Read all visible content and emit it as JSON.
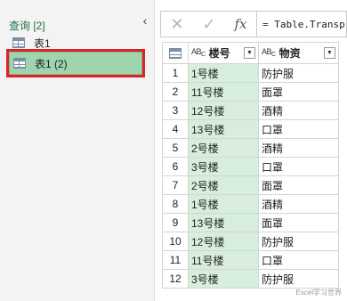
{
  "queries_pane": {
    "header": "查询 [2]",
    "collapse_glyph": "‹",
    "items": [
      {
        "label": "表1"
      },
      {
        "label": "表1 (2)"
      }
    ]
  },
  "formula_bar": {
    "cancel_glyph": "✕",
    "confirm_glyph": "✓",
    "fx_label": "fx",
    "formula": "= Table.Transp"
  },
  "grid": {
    "columns": [
      {
        "type_icon": "ABC",
        "label": "楼号"
      },
      {
        "type_icon": "ABC",
        "label": "物资"
      }
    ],
    "rows": [
      {
        "index": "1",
        "a": "1号楼",
        "b": "防护服"
      },
      {
        "index": "2",
        "a": "11号楼",
        "b": "面罩"
      },
      {
        "index": "3",
        "a": "12号楼",
        "b": "酒精"
      },
      {
        "index": "4",
        "a": "13号楼",
        "b": "口罩"
      },
      {
        "index": "5",
        "a": "2号楼",
        "b": "酒精"
      },
      {
        "index": "6",
        "a": "3号楼",
        "b": "口罩"
      },
      {
        "index": "7",
        "a": "2号楼",
        "b": "面罩"
      },
      {
        "index": "8",
        "a": "1号楼",
        "b": "酒精"
      },
      {
        "index": "9",
        "a": "13号楼",
        "b": "面罩"
      },
      {
        "index": "10",
        "a": "12号楼",
        "b": "防护服"
      },
      {
        "index": "11",
        "a": "11号楼",
        "b": "口罩"
      },
      {
        "index": "12",
        "a": "3号楼",
        "b": "防护服"
      }
    ]
  },
  "watermark": "Excel学习世界",
  "colors": {
    "selected_query_bg": "#9fd4ad",
    "highlight_border": "#e0202a",
    "selected_column_bg": "#d7eedd",
    "header_text": "#217346"
  }
}
